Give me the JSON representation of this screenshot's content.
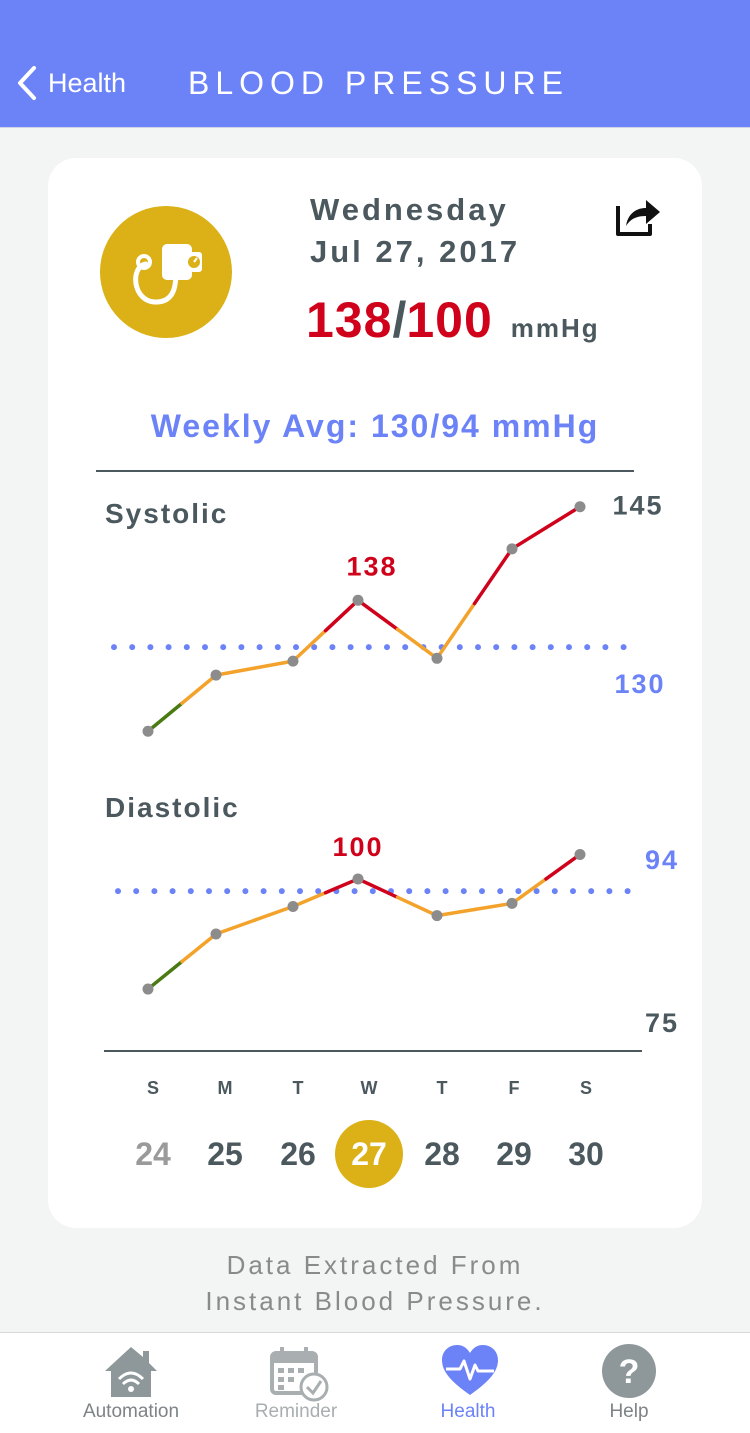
{
  "nav": {
    "back_label": "Health",
    "title": "BLOOD PRESSURE"
  },
  "summary": {
    "day_of_week": "Wednesday",
    "date": "Jul 27, 2017",
    "systolic": "138",
    "separator": "/",
    "diastolic": "100",
    "unit": "mmHg",
    "weekly_avg": "Weekly Avg: 130/94 mmHg"
  },
  "charts": {
    "systolic_label": "Systolic",
    "diastolic_label": "Diastolic"
  },
  "chart_data": [
    {
      "type": "line",
      "name": "Systolic",
      "x": [
        "S",
        "M",
        "T",
        "W",
        "T",
        "F",
        "S"
      ],
      "values": [
        121,
        127,
        128.5,
        135,
        128.8,
        140.5,
        145
      ],
      "average": 130,
      "max_label": "145",
      "avg_label": "130",
      "peak_label": "138",
      "ylim": [
        119,
        147
      ],
      "colors": {
        "low": "#4a7a12",
        "mid": "#f3a32b",
        "high": "#d0021b",
        "avg": "#6c83f8",
        "point": "#8c8c8c"
      },
      "thresholds": [
        125,
        130
      ]
    },
    {
      "type": "line",
      "name": "Diastolic",
      "x": [
        "S",
        "M",
        "T",
        "W",
        "T",
        "F",
        "S"
      ],
      "values": [
        78,
        87,
        91.5,
        96,
        90,
        92,
        100
      ],
      "average": 94,
      "max_label": "94",
      "min_label": "75",
      "peak_label": "100",
      "ylim": [
        70,
        104
      ],
      "colors": {
        "low": "#4a7a12",
        "mid": "#f3a32b",
        "high": "#d0021b",
        "avg": "#6c83f8",
        "point": "#8c8c8c"
      },
      "thresholds": [
        82,
        94
      ]
    }
  ],
  "week": {
    "letters": [
      "S",
      "M",
      "T",
      "W",
      "T",
      "F",
      "S"
    ],
    "days": [
      "24",
      "25",
      "26",
      "27",
      "28",
      "29",
      "30"
    ],
    "selected_index": 3
  },
  "footer": {
    "line1": "Data Extracted From",
    "line2": "Instant Blood Pressure."
  },
  "tabs": [
    {
      "label": "Automation",
      "icon": "home-wifi-icon"
    },
    {
      "label": "Reminder",
      "icon": "calendar-check-icon"
    },
    {
      "label": "Health",
      "icon": "heart-pulse-icon"
    },
    {
      "label": "Help",
      "icon": "help-icon"
    }
  ],
  "colors": {
    "brand": "#6c83f8",
    "accent": "#dbb117",
    "alert": "#d0021b",
    "text": "#4b585e"
  }
}
